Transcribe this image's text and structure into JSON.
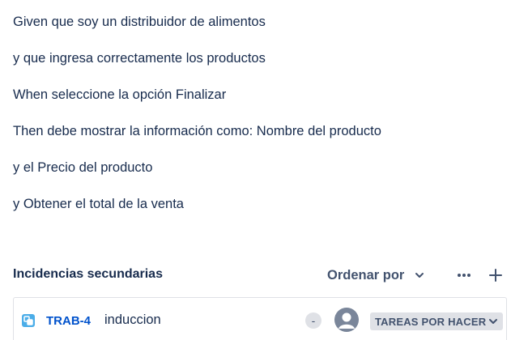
{
  "description": {
    "lines": [
      "Given que soy un distribuidor de alimentos",
      "y que ingresa correctamente los productos",
      "When seleccione la opción Finalizar",
      "Then debe mostrar la información como: Nombre del producto",
      "y el Precio del producto",
      "y  Obtener el total de la venta"
    ]
  },
  "subtasks": {
    "title": "Incidencias secundarias",
    "order_label": "Ordenar por",
    "more_icon": "more-icon",
    "add_icon": "plus-icon",
    "items": [
      {
        "key": "TRAB-4",
        "summary": "induccion",
        "priority": "-",
        "status": "TAREAS POR HACER",
        "type_color": "#4bade8"
      }
    ]
  }
}
